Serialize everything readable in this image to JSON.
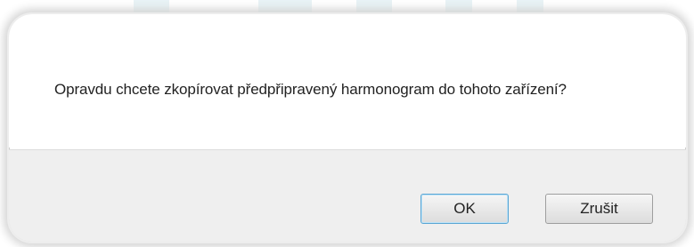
{
  "dialog": {
    "message": "Opravdu chcete zkopírovat předpřipravený harmonogram do tohoto zařízení?",
    "ok_label": "OK",
    "cancel_label": "Zrušit"
  },
  "colors": {
    "footer_background": "#efefef",
    "ok_border_accent": "#5aa6d4",
    "dialog_background": "#ffffff"
  }
}
